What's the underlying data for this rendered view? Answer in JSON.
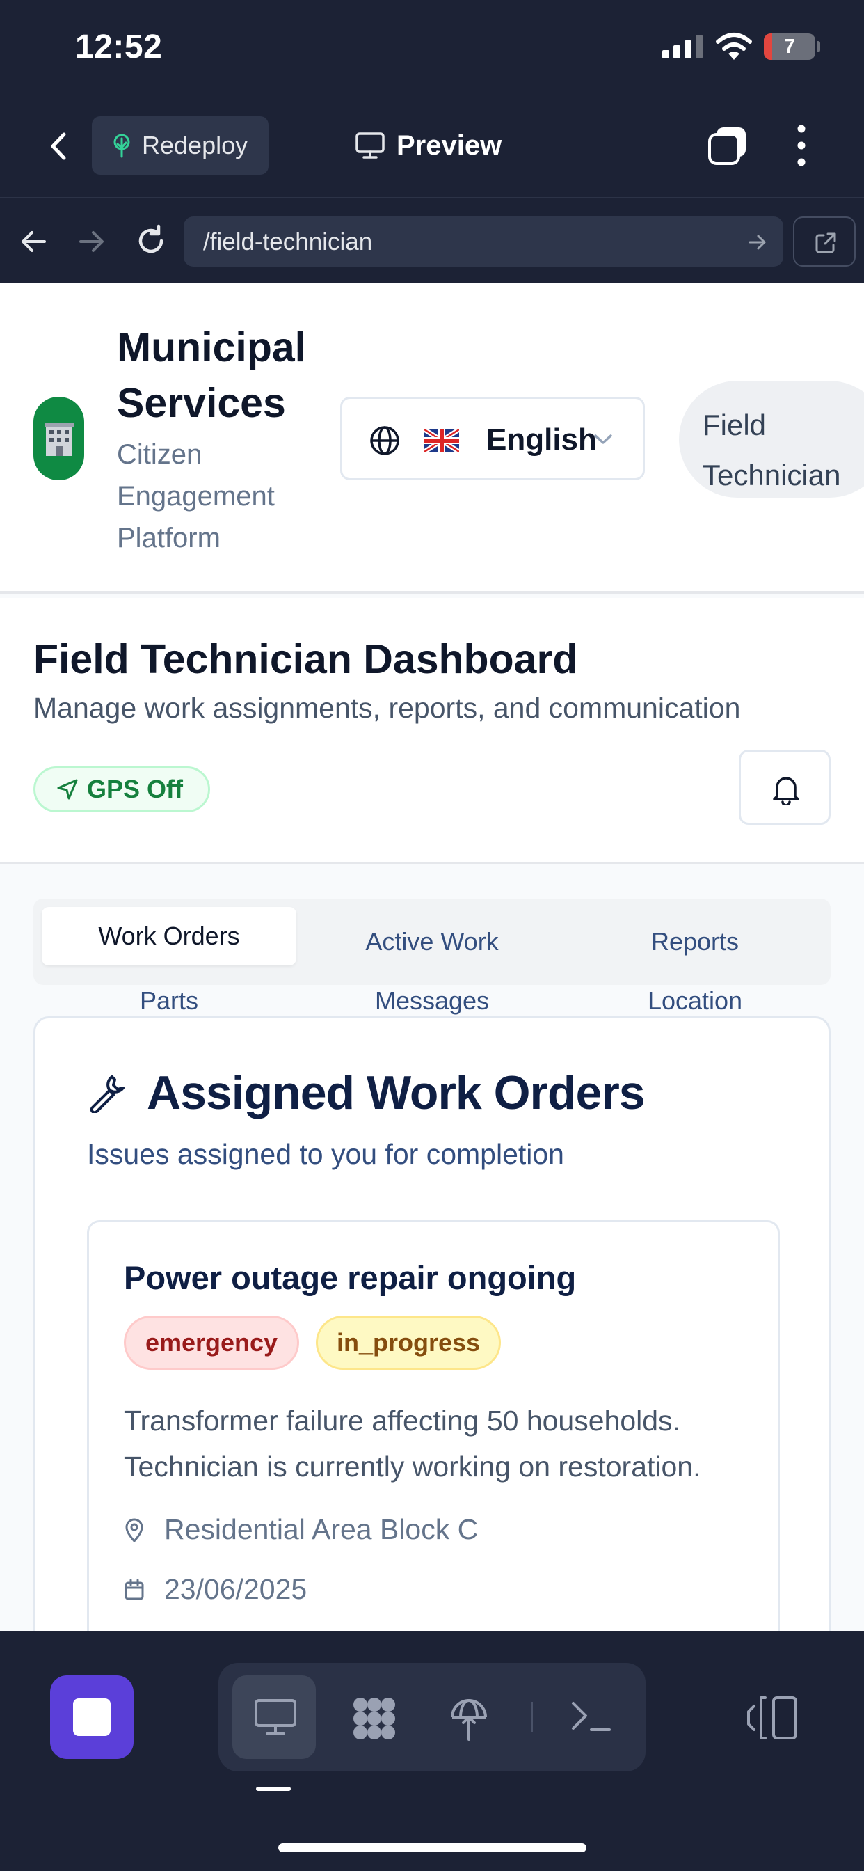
{
  "status_bar": {
    "time": "12:52",
    "battery": "7"
  },
  "toolbar": {
    "redeploy_label": "Redeploy",
    "preview_label": "Preview"
  },
  "browser": {
    "url": "/field-technician"
  },
  "header": {
    "brand_title": "Municipal Services",
    "brand_subtitle": "Citizen Engagement Platform",
    "language": "English",
    "role": "Field Technician"
  },
  "dashboard": {
    "title": "Field Technician Dashboard",
    "subtitle": "Manage work assignments, reports, and communication",
    "gps_label": "GPS Off"
  },
  "tabs": {
    "row1": [
      "Work Orders",
      "Active Work",
      "Reports"
    ],
    "row2": [
      "Parts",
      "Messages",
      "Location"
    ],
    "active": "Work Orders"
  },
  "card": {
    "title": "Assigned Work Orders",
    "subtitle": "Issues assigned to you for completion",
    "work_orders": [
      {
        "title": "Power outage repair ongoing",
        "priority": "emergency",
        "status": "in_progress",
        "description": "Transformer failure affecting 50 households. Technician is currently working on restoration.",
        "location": "Residential Area Block C",
        "date": "23/06/2025"
      }
    ]
  },
  "colors": {
    "chrome_bg": "#1c2235",
    "accent_purple": "#5b3fd9",
    "logo_green": "#0f8a43",
    "gps_green": "#15803d",
    "emergency_red": "#991b1b",
    "status_yellow": "#854d0e"
  },
  "icons": {
    "status_bar": [
      "signal-icon",
      "wifi-icon",
      "battery-icon"
    ],
    "toolbar": [
      "chevron-left-icon",
      "tree-icon",
      "monitor-icon",
      "tabs-icon",
      "more-vertical-icon"
    ],
    "browser": [
      "arrow-left-icon",
      "arrow-right-icon",
      "reload-icon",
      "arrow-right-icon",
      "external-link-icon"
    ],
    "content": [
      "building-icon",
      "globe-icon",
      "uk-flag-icon",
      "chevron-down-icon",
      "navigation-icon",
      "bell-icon",
      "wrench-icon",
      "map-pin-icon",
      "calendar-icon"
    ],
    "dock": [
      "stop-icon",
      "monitor-icon",
      "apps-icon",
      "deploy-icon",
      "terminal-icon",
      "panel-icon"
    ]
  }
}
